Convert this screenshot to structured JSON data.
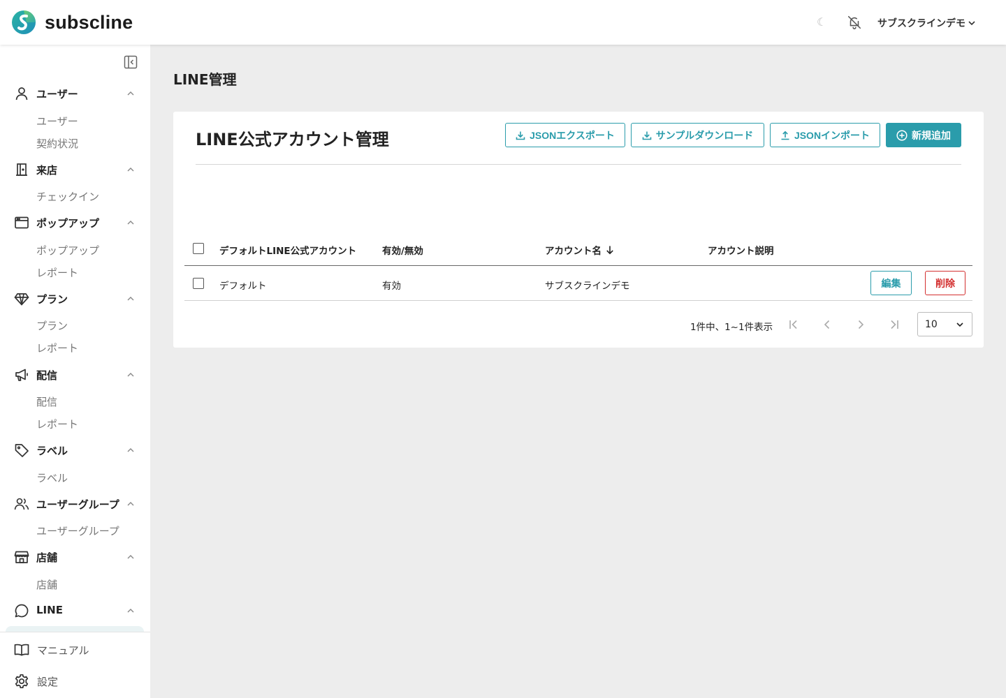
{
  "app": {
    "brand": "subscline"
  },
  "header": {
    "theme_icon": "moon-icon",
    "user_name": "サブスクラインデモ"
  },
  "sidebar": {
    "groups": [
      {
        "label": "ユーザー",
        "icon": "user-icon",
        "items": [
          "ユーザー",
          "契約状況"
        ]
      },
      {
        "label": "来店",
        "icon": "door-icon",
        "items": [
          "チェックイン"
        ]
      },
      {
        "label": "ポップアップ",
        "icon": "window-icon",
        "items": [
          "ポップアップ",
          "レポート"
        ]
      },
      {
        "label": "プラン",
        "icon": "diamond-icon",
        "items": [
          "プラン",
          "レポート"
        ]
      },
      {
        "label": "配信",
        "icon": "megaphone-icon",
        "items": [
          "配信",
          "レポート"
        ]
      },
      {
        "label": "ラベル",
        "icon": "tag-icon",
        "items": [
          "ラベル"
        ]
      },
      {
        "label": "ユーザーグループ",
        "icon": "users-icon",
        "items": [
          "ユーザーグループ"
        ]
      },
      {
        "label": "店舗",
        "icon": "store-icon",
        "items": [
          "店舗"
        ]
      },
      {
        "label": "LINE",
        "icon": "chat-icon",
        "items": []
      }
    ],
    "bottom": [
      {
        "label": "マニュアル",
        "icon": "book-icon"
      },
      {
        "label": "設定",
        "icon": "gear-icon"
      }
    ]
  },
  "main": {
    "page_title": "LINE管理",
    "card_title": "LINE公式アカウント管理",
    "actions": {
      "export": "JSONエクスポート",
      "sample": "サンプルダウンロード",
      "import": "JSONインポート",
      "add": "新規追加"
    },
    "table": {
      "columns": [
        "デフォルトLINE公式アカウント",
        "有効/無効",
        "アカウント名",
        "アカウント説明"
      ],
      "sorted_column": "アカウント名",
      "rows": [
        {
          "default": "デフォルト",
          "status": "有効",
          "name": "サブスクラインデモ",
          "description": "",
          "edit": "編集",
          "delete": "削除"
        }
      ]
    },
    "pagination": {
      "summary": "1件中、1~1件表示",
      "page_size": "10"
    }
  }
}
